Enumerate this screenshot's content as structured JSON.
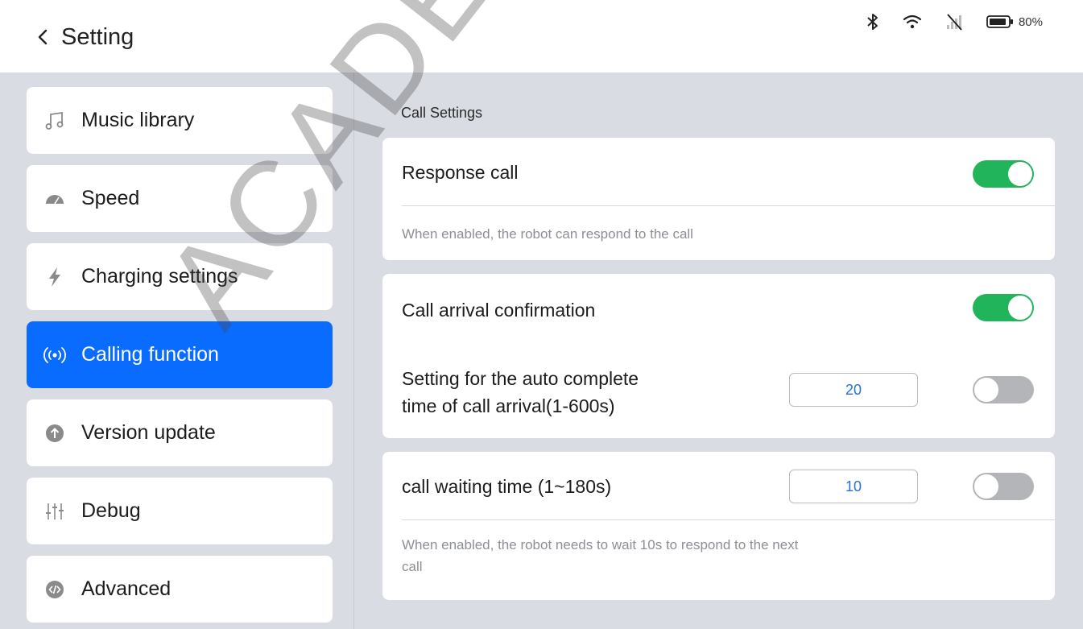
{
  "header": {
    "title": "Setting",
    "battery_percent": "80%",
    "icons": [
      "back-arrow-icon",
      "bluetooth-icon",
      "wifi-icon",
      "no-signal-icon",
      "battery-icon"
    ]
  },
  "sidebar": {
    "items": [
      {
        "label": "Music library",
        "icon": "music-note-icon"
      },
      {
        "label": "Speed",
        "icon": "speedometer-icon"
      },
      {
        "label": "Charging settings",
        "icon": "lightning-icon"
      },
      {
        "label": "Calling function",
        "icon": "broadcast-icon",
        "active": true
      },
      {
        "label": "Version update",
        "icon": "upload-arrow-icon"
      },
      {
        "label": "Debug",
        "icon": "sliders-icon"
      },
      {
        "label": "Advanced",
        "icon": "code-icon"
      }
    ]
  },
  "main": {
    "section_title": "Call Settings",
    "response_call": {
      "label": "Response call",
      "enabled": true,
      "description": "When enabled, the robot can respond to the call"
    },
    "arrival_confirmation": {
      "label": "Call arrival confirmation",
      "enabled": true,
      "auto_complete_label_line1": "Setting for the auto complete",
      "auto_complete_label_line2": "time of call arrival(1-600s)",
      "auto_complete_value": "20",
      "auto_complete_enabled": false
    },
    "waiting_time": {
      "label": "call waiting time (1~180s)",
      "value": "10",
      "enabled": false,
      "description_line1": "When enabled, the robot needs to wait 10s to respond to the next",
      "description_line2": "call"
    }
  },
  "watermark": "ACADEMY",
  "colors": {
    "accent": "#0a6cff",
    "toggle_on": "#22b45b",
    "toggle_off": "#b3b5b9",
    "background": "#d9dce3"
  }
}
